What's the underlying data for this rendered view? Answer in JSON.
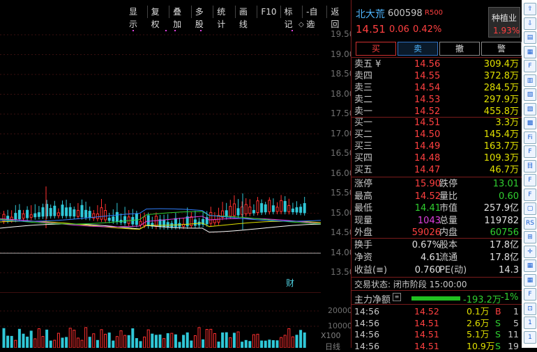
{
  "topbar": [
    "显示",
    "复权",
    "叠加",
    "多股",
    "统计",
    "画线",
    "F10",
    "标记",
    "-自选",
    "返回"
  ],
  "price_axis": [
    "19.50",
    "19.00",
    "18.50",
    "18.00",
    "17.50",
    "17.00",
    "16.50",
    "16.00",
    "15.50",
    "15.00",
    "14.50",
    "14.00",
    "13.50"
  ],
  "vol_axis": [
    "20000",
    "10000"
  ],
  "vol_multiplier": "X100",
  "vol_footer": "日线",
  "cai_badge": "财",
  "stock": {
    "name": "北大荒",
    "code": "600598",
    "r": "R",
    "r_code": "500",
    "price": "14.51",
    "change": "0.06",
    "pct": "0.42%"
  },
  "industry": {
    "name": "种植业",
    "pct": "1.93%"
  },
  "buttons": [
    "买",
    "卖",
    "撤",
    "警"
  ],
  "asks": [
    {
      "label": "卖五 ¥",
      "price": "14.56",
      "vol": "309.4万"
    },
    {
      "label": "卖四",
      "price": "14.55",
      "vol": "372.8万"
    },
    {
      "label": "卖三",
      "price": "14.54",
      "vol": "284.5万"
    },
    {
      "label": "卖二",
      "price": "14.53",
      "vol": "297.9万"
    },
    {
      "label": "卖一",
      "price": "14.52",
      "vol": "455.8万"
    }
  ],
  "bids": [
    {
      "label": "买一",
      "price": "14.51",
      "vol": "3.3万"
    },
    {
      "label": "买二",
      "price": "14.50",
      "vol": "145.4万"
    },
    {
      "label": "买三",
      "price": "14.49",
      "vol": "163.7万"
    },
    {
      "label": "买四",
      "price": "14.48",
      "vol": "109.3万"
    },
    {
      "label": "买五",
      "price": "14.47",
      "vol": "46.7万"
    }
  ],
  "stats1": [
    {
      "l1": "涨停",
      "v1": "15.90",
      "c1": "red",
      "l2": "跌停",
      "v2": "13.01",
      "c2": "green"
    },
    {
      "l1": "最高",
      "v1": "14.52",
      "c1": "red",
      "l2": "量比",
      "v2": "0.60",
      "c2": "green"
    },
    {
      "l1": "最低",
      "v1": "14.41",
      "c1": "green",
      "l2": "市值",
      "v2": "257.9亿",
      "c2": "white"
    },
    {
      "l1": "现量",
      "v1": "1043",
      "c1": "magenta",
      "l2": "总量",
      "v2": "119782",
      "c2": "white"
    },
    {
      "l1": "外盘",
      "v1": "59026",
      "c1": "red",
      "l2": "内盘",
      "v2": "60756",
      "c2": "green"
    }
  ],
  "stats2": [
    {
      "l1": "换手",
      "v1": "0.67%",
      "l2": "股本",
      "v2": "17.8亿"
    },
    {
      "l1": "净资",
      "v1": "4.61",
      "l2": "流通",
      "v2": "17.8亿"
    },
    {
      "l1": "收益(≡)",
      "v1": "0.760",
      "l2": "PE(动)",
      "v2": "14.3"
    }
  ],
  "status": "交易状态: 闭市阶段 15:00:00",
  "mainforce": {
    "label": "主力净额",
    "value": "-193.2万",
    "pct": "-1%"
  },
  "trades": [
    {
      "time": "14:56",
      "price": "14.52",
      "vol": "0.1万",
      "dir": "B",
      "n": "1"
    },
    {
      "time": "14:56",
      "price": "14.51",
      "vol": "2.6万",
      "dir": "S",
      "n": "5"
    },
    {
      "time": "14:56",
      "price": "14.51",
      "vol": "5.1万",
      "dir": "S",
      "n": "11"
    },
    {
      "time": "14:56",
      "price": "14.51",
      "vol": "10.9万",
      "dir": "S",
      "n": "19"
    }
  ],
  "tools": [
    "⇧",
    "⇩",
    "▤",
    "▦",
    "F",
    "▥",
    "▧",
    "▨",
    "▩",
    "Fi",
    "F",
    "目",
    "F",
    "F",
    "▢",
    "RS",
    "⊞",
    "✛",
    "▦",
    "▦",
    "F",
    "⊡",
    "1",
    "1"
  ]
}
